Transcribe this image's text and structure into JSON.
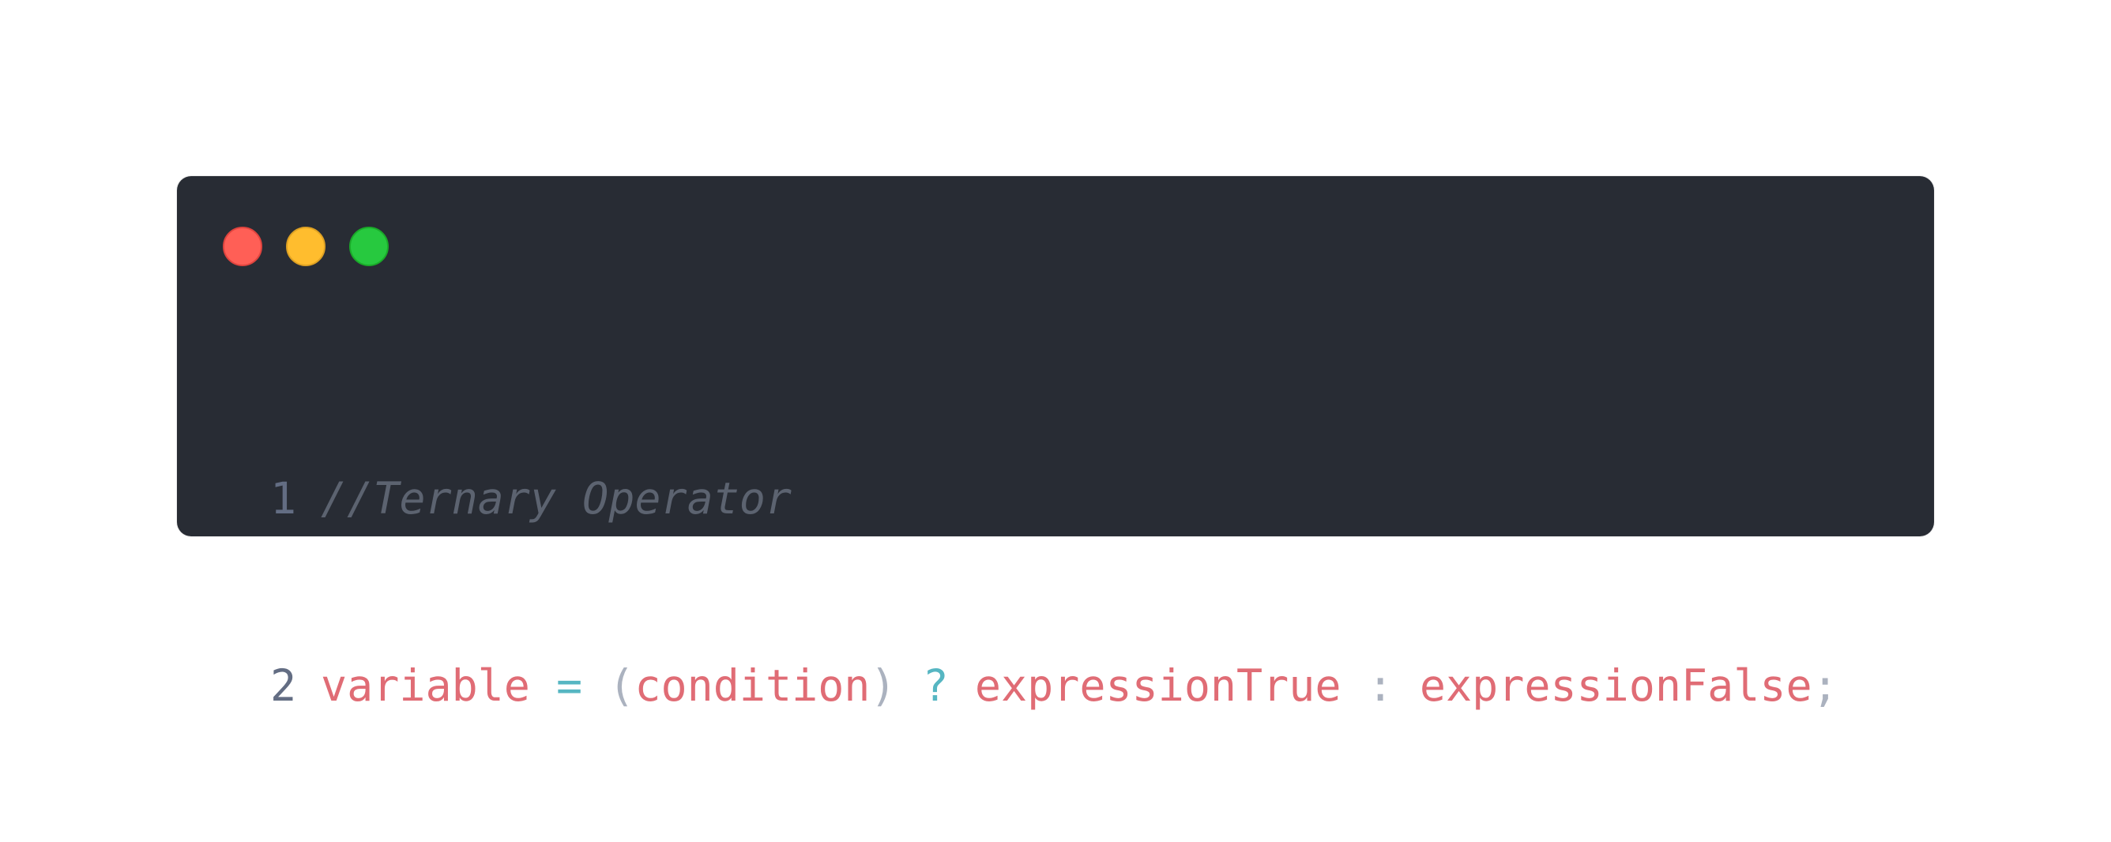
{
  "window": {
    "traffic_lights": [
      {
        "name": "close",
        "color": "#ff5f56"
      },
      {
        "name": "minimize",
        "color": "#ffbd2e"
      },
      {
        "name": "maximize",
        "color": "#27c93f"
      }
    ],
    "background": "#282c34"
  },
  "code": {
    "lines": [
      {
        "number": "1",
        "comment": "//Ternary Operator"
      },
      {
        "number": "2",
        "tokens": {
          "t1": "variable",
          "t2": "=",
          "t3": "(",
          "t4": "condition",
          "t5": ")",
          "t6": "?",
          "t7": "expressionTrue",
          "t8": ":",
          "t9": "expressionFalse",
          "t10": ";"
        }
      }
    ]
  },
  "colors": {
    "comment": "#5c6370",
    "identifier": "#e06c75",
    "operator": "#56b6c2",
    "punctuation": "#abb2bf",
    "line_number": "#636d83"
  }
}
